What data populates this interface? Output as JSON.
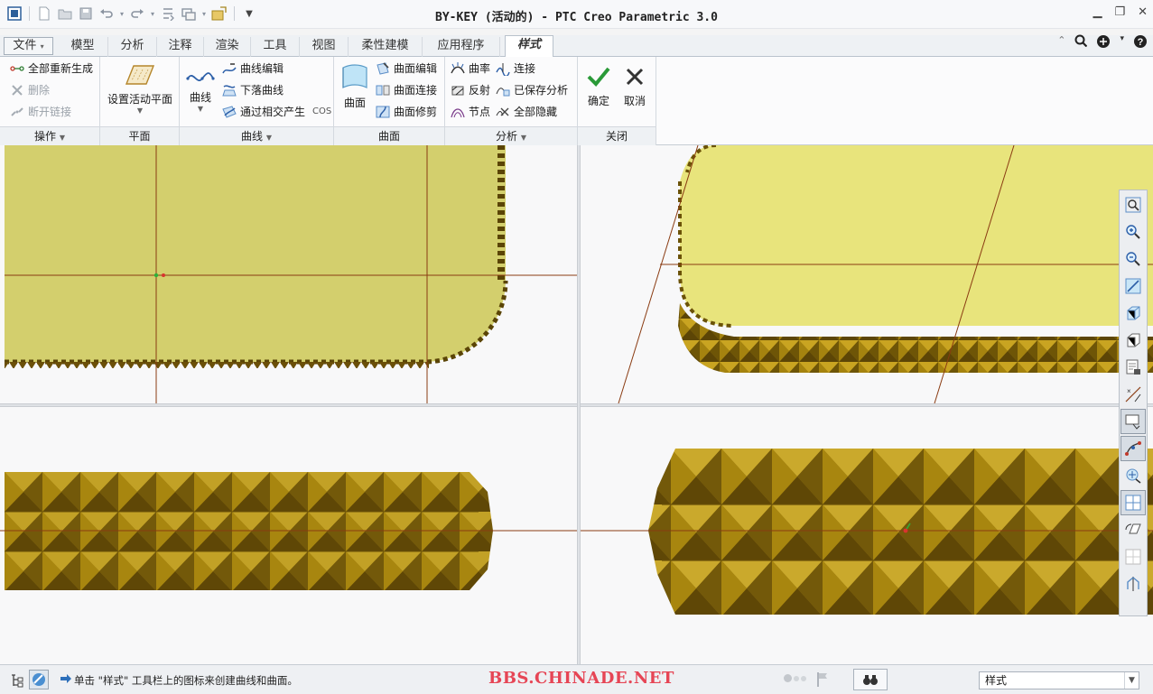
{
  "window": {
    "title": "BY-KEY (活动的) - PTC Creo Parametric 3.0",
    "controls": [
      "minimize",
      "restore",
      "close"
    ]
  },
  "quick_access": [
    "new-icon",
    "open-icon",
    "save-icon",
    "undo-icon",
    "redo-icon",
    "regenerate-icon",
    "windows-icon",
    "close-window-icon",
    "customize-icon"
  ],
  "tabs": {
    "file": "文件",
    "items": [
      "模型",
      "分析",
      "注释",
      "渲染",
      "工具",
      "视图",
      "柔性建模",
      "应用程序",
      "样式"
    ],
    "active": "样式"
  },
  "ribbon": {
    "ops": {
      "label": "操作",
      "regen": "全部重新生成",
      "delete": "删除",
      "break_link": "断开链接"
    },
    "plane": {
      "label": "平面",
      "set_active": "设置活动平面"
    },
    "curves": {
      "label": "曲线",
      "curve": "曲线",
      "curve_edit": "曲线编辑",
      "drop_curve": "下落曲线",
      "through_intersect": "通过相交产生",
      "cos": "COS"
    },
    "surfaces": {
      "label": "曲面",
      "surface": "曲面",
      "surface_edit": "曲面编辑",
      "surface_connect": "曲面连接",
      "surface_trim": "曲面修剪"
    },
    "analysis": {
      "label": "分析",
      "curvature": "曲率",
      "connect": "连接",
      "reflect": "反射",
      "saved": "已保存分析",
      "node": "节点",
      "hide_all": "全部隐藏"
    },
    "close": {
      "label": "关闭",
      "ok": "确定",
      "cancel": "取消"
    }
  },
  "status": {
    "message": "单击 \"样式\" 工具栏上的图标来创建曲线和曲面。",
    "watermark": "BBS.CHINADE.NET",
    "filter_value": "样式"
  },
  "colors": {
    "surface_top": "#d3cf6d",
    "surface_persp": "#e8e47c",
    "gold_dark": "#7a5c05",
    "gold_mid": "#a98412",
    "gold_light": "#e8cb4a",
    "datum_line": "#8a3b12",
    "watermark": "#e64555",
    "ok_check": "#2a9a38"
  }
}
